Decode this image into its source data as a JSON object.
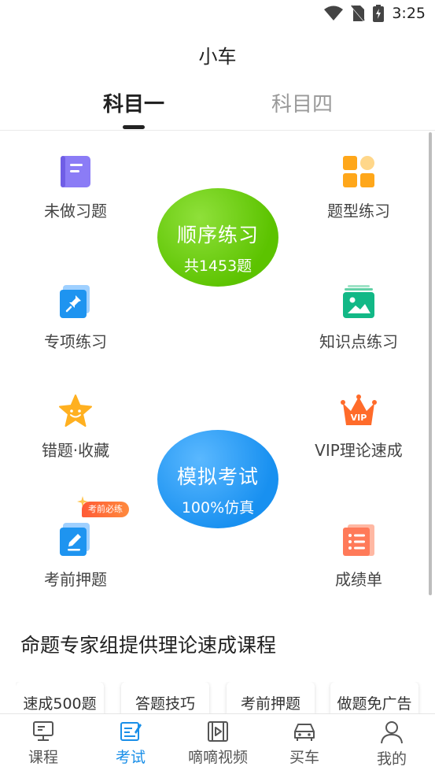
{
  "status_bar": {
    "time": "3:25"
  },
  "header": {
    "title": "小车"
  },
  "tabs": [
    {
      "label": "科目一",
      "active": true
    },
    {
      "label": "科目四",
      "active": false
    }
  ],
  "grid": {
    "left_items": [
      {
        "label": "未做习题",
        "icon": "notebook-icon"
      },
      {
        "label": "专项练习",
        "icon": "pin-icon"
      },
      {
        "label": "错题·收藏",
        "icon": "star-icon"
      },
      {
        "label": "考前押题",
        "icon": "edit-icon",
        "badge": "考前必练"
      }
    ],
    "right_items": [
      {
        "label": "题型练习",
        "icon": "category-grid-icon"
      },
      {
        "label": "知识点练习",
        "icon": "image-card-icon"
      },
      {
        "label": "VIP理论速成",
        "icon": "vip-crown-icon"
      },
      {
        "label": "成绩单",
        "icon": "report-list-icon"
      }
    ],
    "sequential_practice": {
      "title": "顺序练习",
      "subtitle": "共1453题"
    },
    "mock_exam": {
      "title": "模拟考试",
      "subtitle": "100%仿真"
    }
  },
  "course_section": {
    "title": "命题专家组提供理论速成课程",
    "chips": [
      "速成500题",
      "答题技巧",
      "考前押题",
      "做题免广告"
    ]
  },
  "bottom_nav": [
    {
      "label": "课程",
      "icon": "monitor-icon",
      "active": false
    },
    {
      "label": "考试",
      "icon": "exam-edit-icon",
      "active": true
    },
    {
      "label": "嘀嘀视频",
      "icon": "video-icon",
      "active": false
    },
    {
      "label": "买车",
      "icon": "car-icon",
      "active": false
    },
    {
      "label": "我的",
      "icon": "person-icon",
      "active": false
    }
  ],
  "colors": {
    "green_circle": "#5cc300",
    "blue_circle": "#1890f0",
    "nav_active": "#1a8fe8",
    "badge": "#ff5a36"
  }
}
